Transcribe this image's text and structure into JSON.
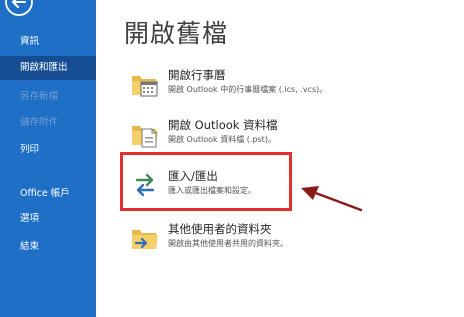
{
  "sidebar": {
    "back_label": "←",
    "items": [
      {
        "label": "資訊",
        "state": "normal"
      },
      {
        "label": "開啟和匯出",
        "state": "selected"
      },
      {
        "label": "另存新檔",
        "state": "disabled"
      },
      {
        "label": "儲存附件",
        "state": "disabled"
      },
      {
        "label": "列印",
        "state": "normal"
      },
      {
        "label": "Office 帳戶",
        "state": "normal"
      },
      {
        "label": "選項",
        "state": "normal"
      },
      {
        "label": "結束",
        "state": "normal"
      }
    ]
  },
  "main": {
    "title": "開啟舊檔",
    "options": [
      {
        "title": "開啟行事曆",
        "description": "開啟 Outlook 中的行事曆檔案 (.ics, .vcs)。",
        "icon": "calendar-folder-icon"
      },
      {
        "title": "開啟 Outlook 資料檔",
        "description": "開啟 Outlook 資料檔 (.pst)。",
        "icon": "data-file-folder-icon"
      },
      {
        "title": "匯入/匯出",
        "description": "匯入或匯出檔案和設定。",
        "icon": "import-export-icon"
      },
      {
        "title": "其他使用者的資料夾",
        "description": "開啟由其他使用者共用的資料夾。",
        "icon": "shared-folder-icon"
      }
    ]
  },
  "colors": {
    "sidebar": "#1f6fc6",
    "sidebar_selected": "#164d93",
    "highlight": "#e03030",
    "annotation_arrow": "#8b1a1a"
  }
}
